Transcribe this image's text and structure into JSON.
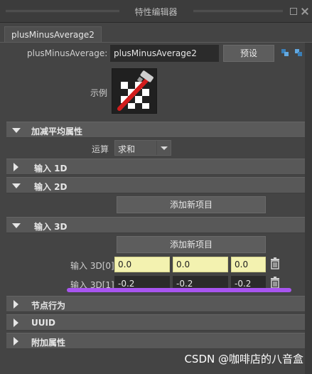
{
  "window": {
    "title": "特性编辑器"
  },
  "tab": {
    "label": "plusMinusAverage2"
  },
  "node": {
    "type_label": "plusMinusAverage:",
    "name_value": "plusMinusAverage2",
    "preset_button": "预设",
    "sample_label": "示例"
  },
  "sections": {
    "main": "加减平均属性",
    "input1d": "输入 1D",
    "input2d": "输入 2D",
    "input3d": "输入 3D",
    "node_behavior": "节点行为",
    "uuid": "UUID",
    "extra": "附加属性"
  },
  "operation": {
    "label": "运算",
    "value": "求和"
  },
  "add_item_label": "添加新项目",
  "input3d_rows": [
    {
      "label": "输入 3D[0]",
      "x": "0.0",
      "y": "0.0",
      "z": "0.0",
      "highlight": true
    },
    {
      "label": "输入 3D[1]",
      "x": "-0.2",
      "y": "-0.2",
      "z": "-0.2",
      "highlight": false
    }
  ],
  "colors": {
    "highlight_field": "#f3f2b0",
    "annotation_underline": "#a855f0"
  },
  "watermark": "CSDN @咖啡店的八音盒"
}
